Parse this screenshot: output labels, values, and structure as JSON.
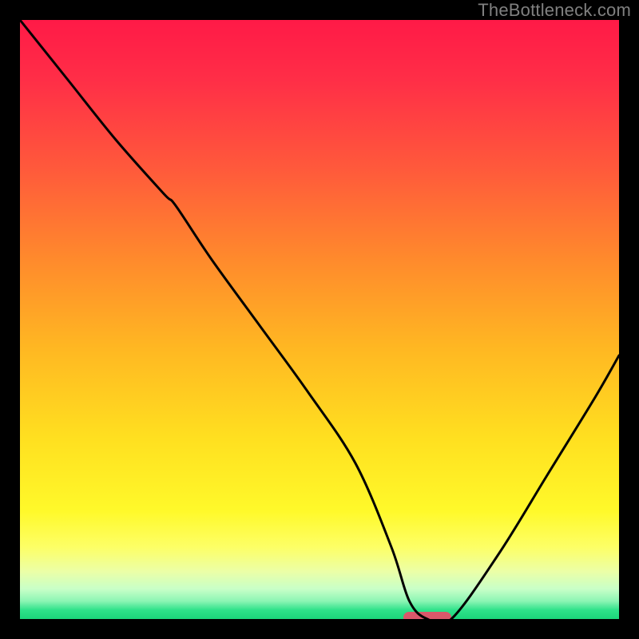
{
  "watermark": "TheBottleneck.com",
  "colors": {
    "curve": "#000000",
    "pill": "#d9586a",
    "frame_bg": "#000000"
  },
  "chart_data": {
    "type": "line",
    "title": "",
    "xlabel": "",
    "ylabel": "",
    "xlim": [
      0,
      100
    ],
    "ylim": [
      0,
      100
    ],
    "note": "Bottleneck-style curve over red→yellow→green vertical gradient. Y high = worse (red), Y low/0 = optimal (green). Minimum around x≈68.",
    "series": [
      {
        "name": "bottleneck_curve",
        "x": [
          0,
          8,
          16,
          24,
          26,
          32,
          40,
          48,
          56,
          62,
          65,
          68,
          72,
          80,
          88,
          96,
          100
        ],
        "y": [
          100,
          90,
          80,
          71,
          69,
          60,
          49,
          38,
          26,
          12,
          3,
          0,
          0,
          11,
          24,
          37,
          44
        ]
      }
    ],
    "optimal_x": 68
  }
}
